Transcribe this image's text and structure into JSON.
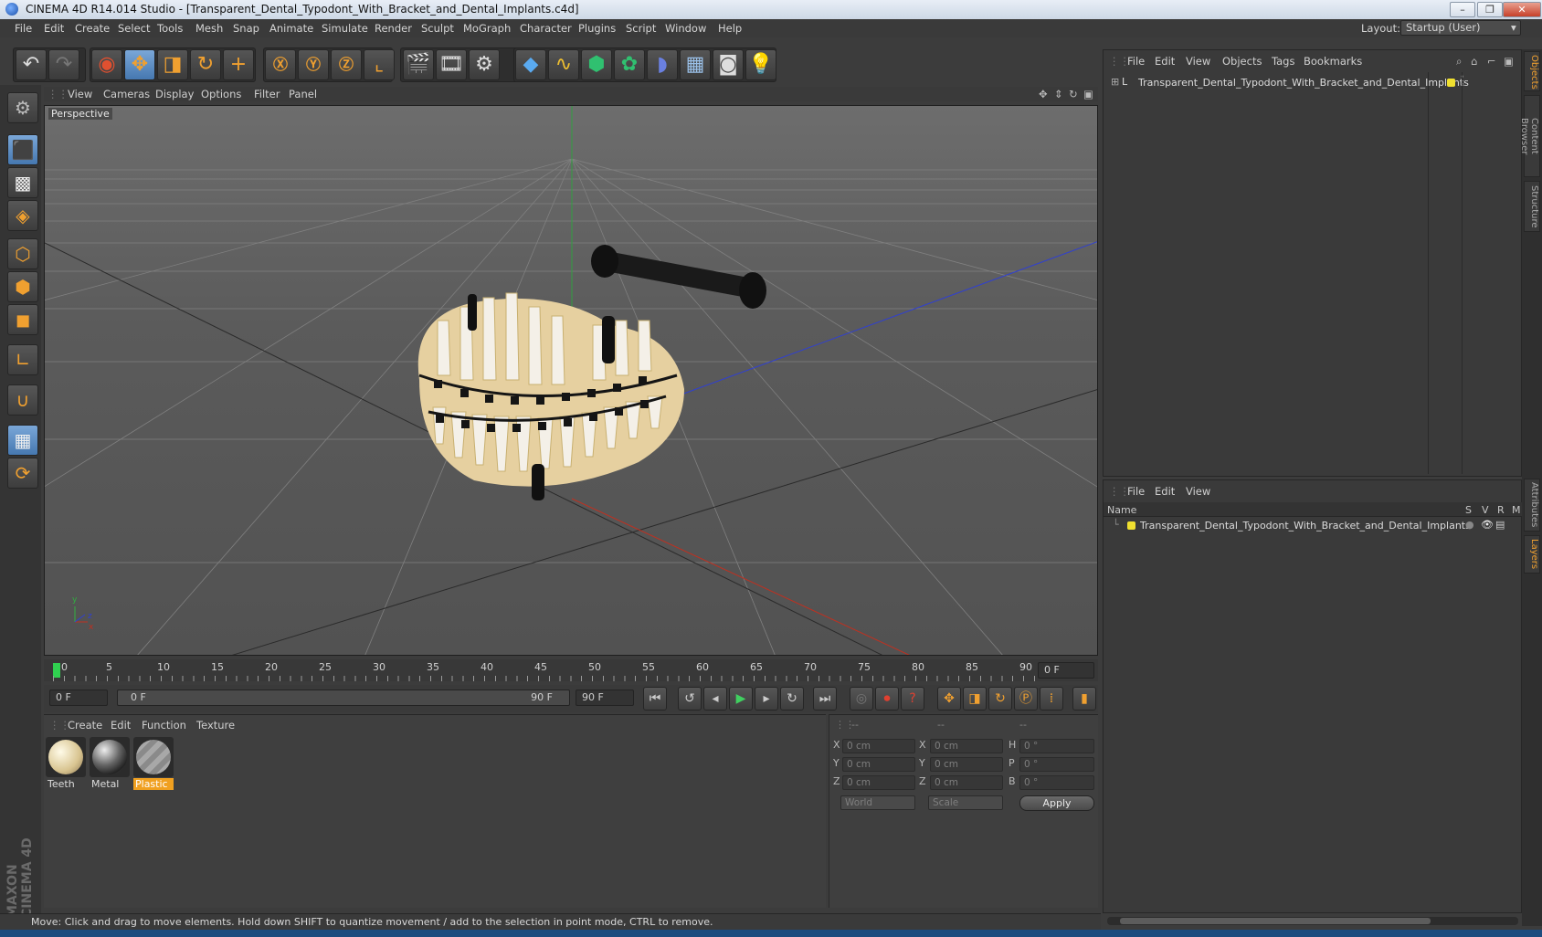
{
  "window": {
    "title": "CINEMA 4D R14.014 Studio - [Transparent_Dental_Typodont_With_Bracket_and_Dental_Implants.c4d]",
    "minimize": "–",
    "restore": "❐",
    "close": "✕"
  },
  "menubar": {
    "items": [
      "File",
      "Edit",
      "Create",
      "Select",
      "Tools",
      "Mesh",
      "Snap",
      "Animate",
      "Simulate",
      "Render",
      "Sculpt",
      "MoGraph",
      "Character",
      "Plugins",
      "Script",
      "Window",
      "Help"
    ],
    "layout_label": "Layout:",
    "layout_value": "Startup (User)"
  },
  "viewport": {
    "menu": [
      "View",
      "Cameras",
      "Display",
      "Options",
      "Filter",
      "Panel"
    ],
    "label": "Perspective",
    "axis_y": "y",
    "axis_x": "x",
    "axis_z": "z"
  },
  "timeline": {
    "ticks": [
      "0",
      "5",
      "10",
      "15",
      "20",
      "25",
      "30",
      "35",
      "40",
      "45",
      "50",
      "55",
      "60",
      "65",
      "70",
      "75",
      "80",
      "85",
      "90"
    ],
    "current_frame": "0 F",
    "start_field": "0 F",
    "range_start": "0 F",
    "range_end": "90 F",
    "end_field": "90 F"
  },
  "materials": {
    "menu": [
      "Create",
      "Edit",
      "Function",
      "Texture"
    ],
    "items": [
      {
        "name": "Teeth",
        "selected": false
      },
      {
        "name": "Metal",
        "selected": false
      },
      {
        "name": "Plastic",
        "selected": true
      }
    ]
  },
  "coordinates": {
    "headers": [
      "--",
      "--",
      "--"
    ],
    "rows": [
      {
        "l1": "X",
        "v1": "0 cm",
        "l2": "X",
        "v2": "0 cm",
        "l3": "H",
        "v3": "0 °"
      },
      {
        "l1": "Y",
        "v1": "0 cm",
        "l2": "Y",
        "v2": "0 cm",
        "l3": "P",
        "v3": "0 °"
      },
      {
        "l1": "Z",
        "v1": "0 cm",
        "l2": "Z",
        "v2": "0 cm",
        "l3": "B",
        "v3": "0 °"
      }
    ],
    "world": "World",
    "scale": "Scale",
    "apply": "Apply"
  },
  "objects_panel": {
    "menu": [
      "File",
      "Edit",
      "View",
      "Objects",
      "Tags",
      "Bookmarks"
    ],
    "object_name": "Transparent_Dental_Typodont_With_Bracket_and_Dental_Implants"
  },
  "layers_panel": {
    "menu": [
      "File",
      "Edit",
      "View"
    ],
    "col_name": "Name",
    "col_s": "S",
    "col_v": "V",
    "col_r": "R",
    "col_m": "M",
    "layer_name": "Transparent_Dental_Typodont_With_Bracket_and_Dental_Implants"
  },
  "side_tabs": [
    "Objects",
    "Content Browser",
    "Structure",
    "Attributes",
    "Layers"
  ],
  "status": "Move: Click and drag to move elements. Hold down SHIFT to quantize movement / add to the selection in point mode, CTRL to remove.",
  "brand": "MAXON CINEMA 4D",
  "colors": {
    "accent": "#f0a030",
    "layer_yellow": "#f0e030",
    "selected_blue": "#4678b0"
  }
}
